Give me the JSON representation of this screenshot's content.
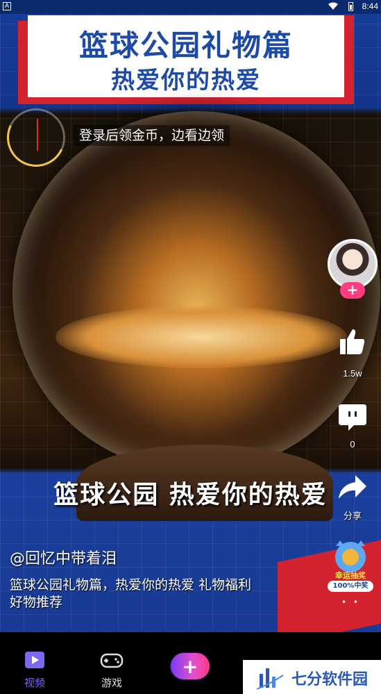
{
  "status_bar": {
    "app_indicator": "A",
    "time": "8:44"
  },
  "video": {
    "title_line1": "篮球公园礼物篇",
    "title_line2": "热爱你的热爱",
    "caption": "篮球公园 热爱你的热爱"
  },
  "coin_banner": "登录后领金币，边看边领",
  "right_rail": {
    "follow_label": "+",
    "like_count": "1.5w",
    "comment_count": "0",
    "share_label": "分享"
  },
  "lucky_draw": {
    "label": "幸运抽奖",
    "sub": "100%中奖"
  },
  "post": {
    "username": "@回忆中带着泪",
    "description": "篮球公园礼物篇，热爱你的热爱 礼物福利  好物推荐"
  },
  "bottom_nav": {
    "items": [
      {
        "label": "视频",
        "icon": "video-icon",
        "active": true
      },
      {
        "label": "游戏",
        "icon": "gamepad-icon",
        "active": false
      }
    ],
    "create_label": "+"
  },
  "watermark": {
    "text": "七分软件园"
  },
  "colors": {
    "accent": "#ff3d7f",
    "brand_blue": "#1d4aa6",
    "brand_red": "#d2232f",
    "nav_active": "#7b68ee"
  }
}
